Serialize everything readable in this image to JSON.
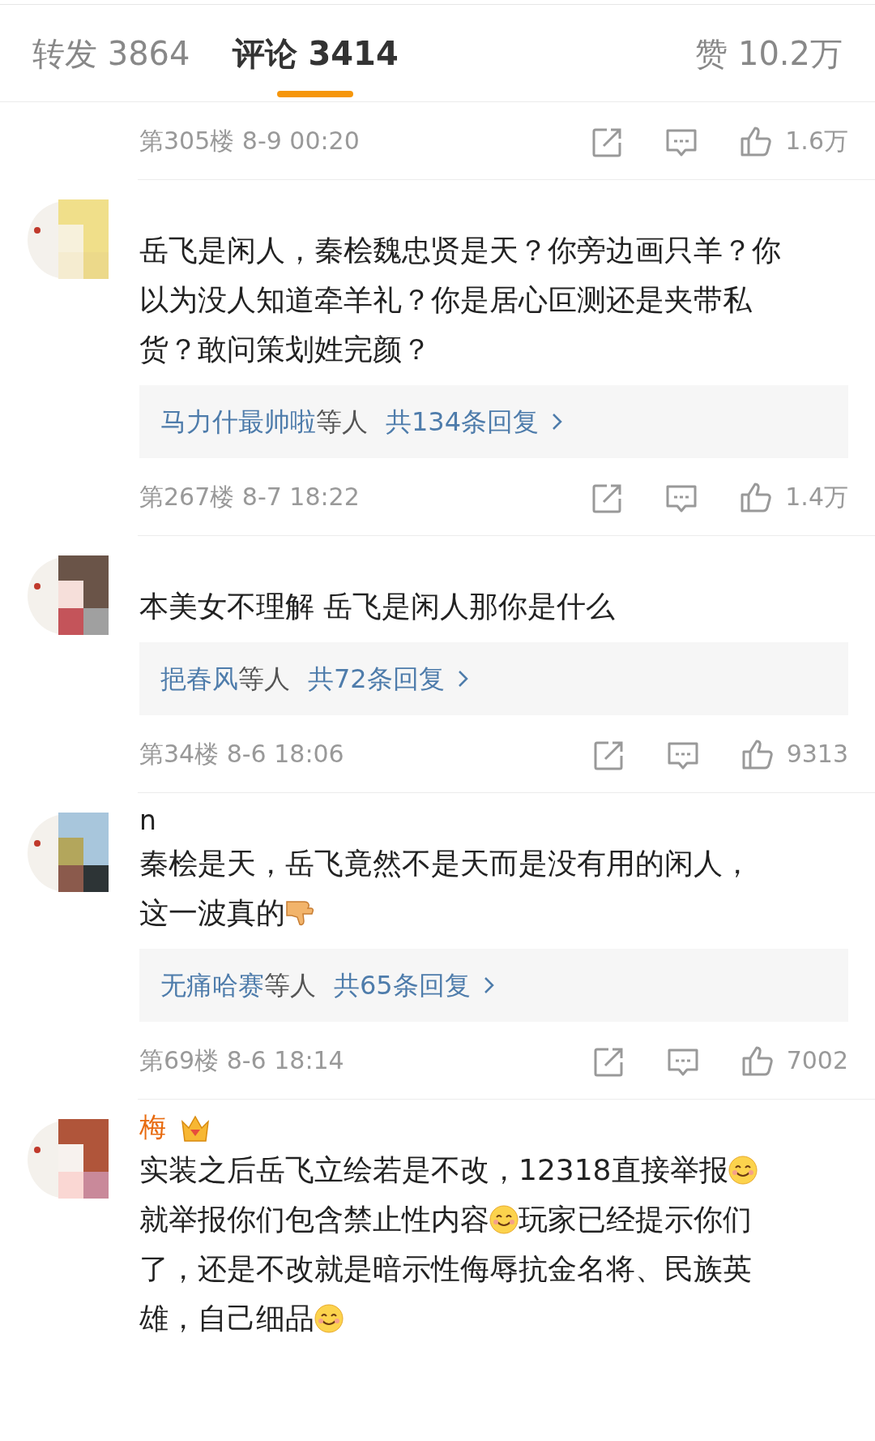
{
  "tabs": [
    {
      "label": "转发 3864",
      "selected": false
    },
    {
      "label": "评论 3414",
      "selected": true
    },
    {
      "label": "赞 10.2万",
      "selected": false
    }
  ],
  "comments": [
    {
      "meta": "第305楼 8-9 00:20",
      "likes": "1.6万"
    },
    {
      "lines": [
        [
          {
            "kind": "text",
            "text": "岳飞是闲人，秦桧魏忠贤是天？你旁边画只羊？你"
          }
        ],
        [
          {
            "kind": "text",
            "text": "以为没人知道牵羊礼？你是居心叵测还是夹带私"
          }
        ],
        [
          {
            "kind": "text",
            "text": "货？敢问策划姓完颜？"
          }
        ]
      ],
      "replies": {
        "users": "马力什最帅啦",
        "suffix": "等人",
        "total": "共134条回复"
      },
      "meta": "第267楼 8-7 18:22",
      "likes": "1.4万"
    },
    {
      "lines": [
        [
          {
            "kind": "text",
            "text": "本美女不理解 岳飞是闲人那你是什么"
          }
        ]
      ],
      "replies": {
        "users": "挹春风",
        "suffix": "等人",
        "total": "共72条回复"
      },
      "meta": "第34楼 8-6 18:06",
      "likes": "9313"
    },
    {
      "name": "n",
      "vip": false,
      "lines": [
        [
          {
            "kind": "text",
            "text": "秦桧是天，岳飞竟然不是天而是没有用的闲人，"
          }
        ],
        [
          {
            "kind": "text",
            "text": "这一波真的"
          },
          {
            "kind": "thumbs_down"
          }
        ]
      ],
      "replies": {
        "users": "无痛哈赛",
        "suffix": "等人",
        "total": "共65条回复"
      },
      "meta": "第69楼 8-6 18:14",
      "likes": "7002"
    },
    {
      "name": "梅",
      "vip": true,
      "lines": [
        [
          {
            "kind": "text",
            "text": "实装之后岳飞立绘若是不改，12318直接举报"
          },
          {
            "kind": "smile"
          }
        ],
        [
          {
            "kind": "text",
            "text": "就举报你们包含禁止性内容"
          },
          {
            "kind": "smile"
          },
          {
            "kind": "text",
            "text": "玩家已经提示你们"
          }
        ],
        [
          {
            "kind": "text",
            "text": "了，还是不改就是暗示性侮辱抗金名将、民族英"
          }
        ],
        [
          {
            "kind": "text",
            "text": "雄，自己细品"
          },
          {
            "kind": "smile"
          }
        ]
      ]
    }
  ]
}
